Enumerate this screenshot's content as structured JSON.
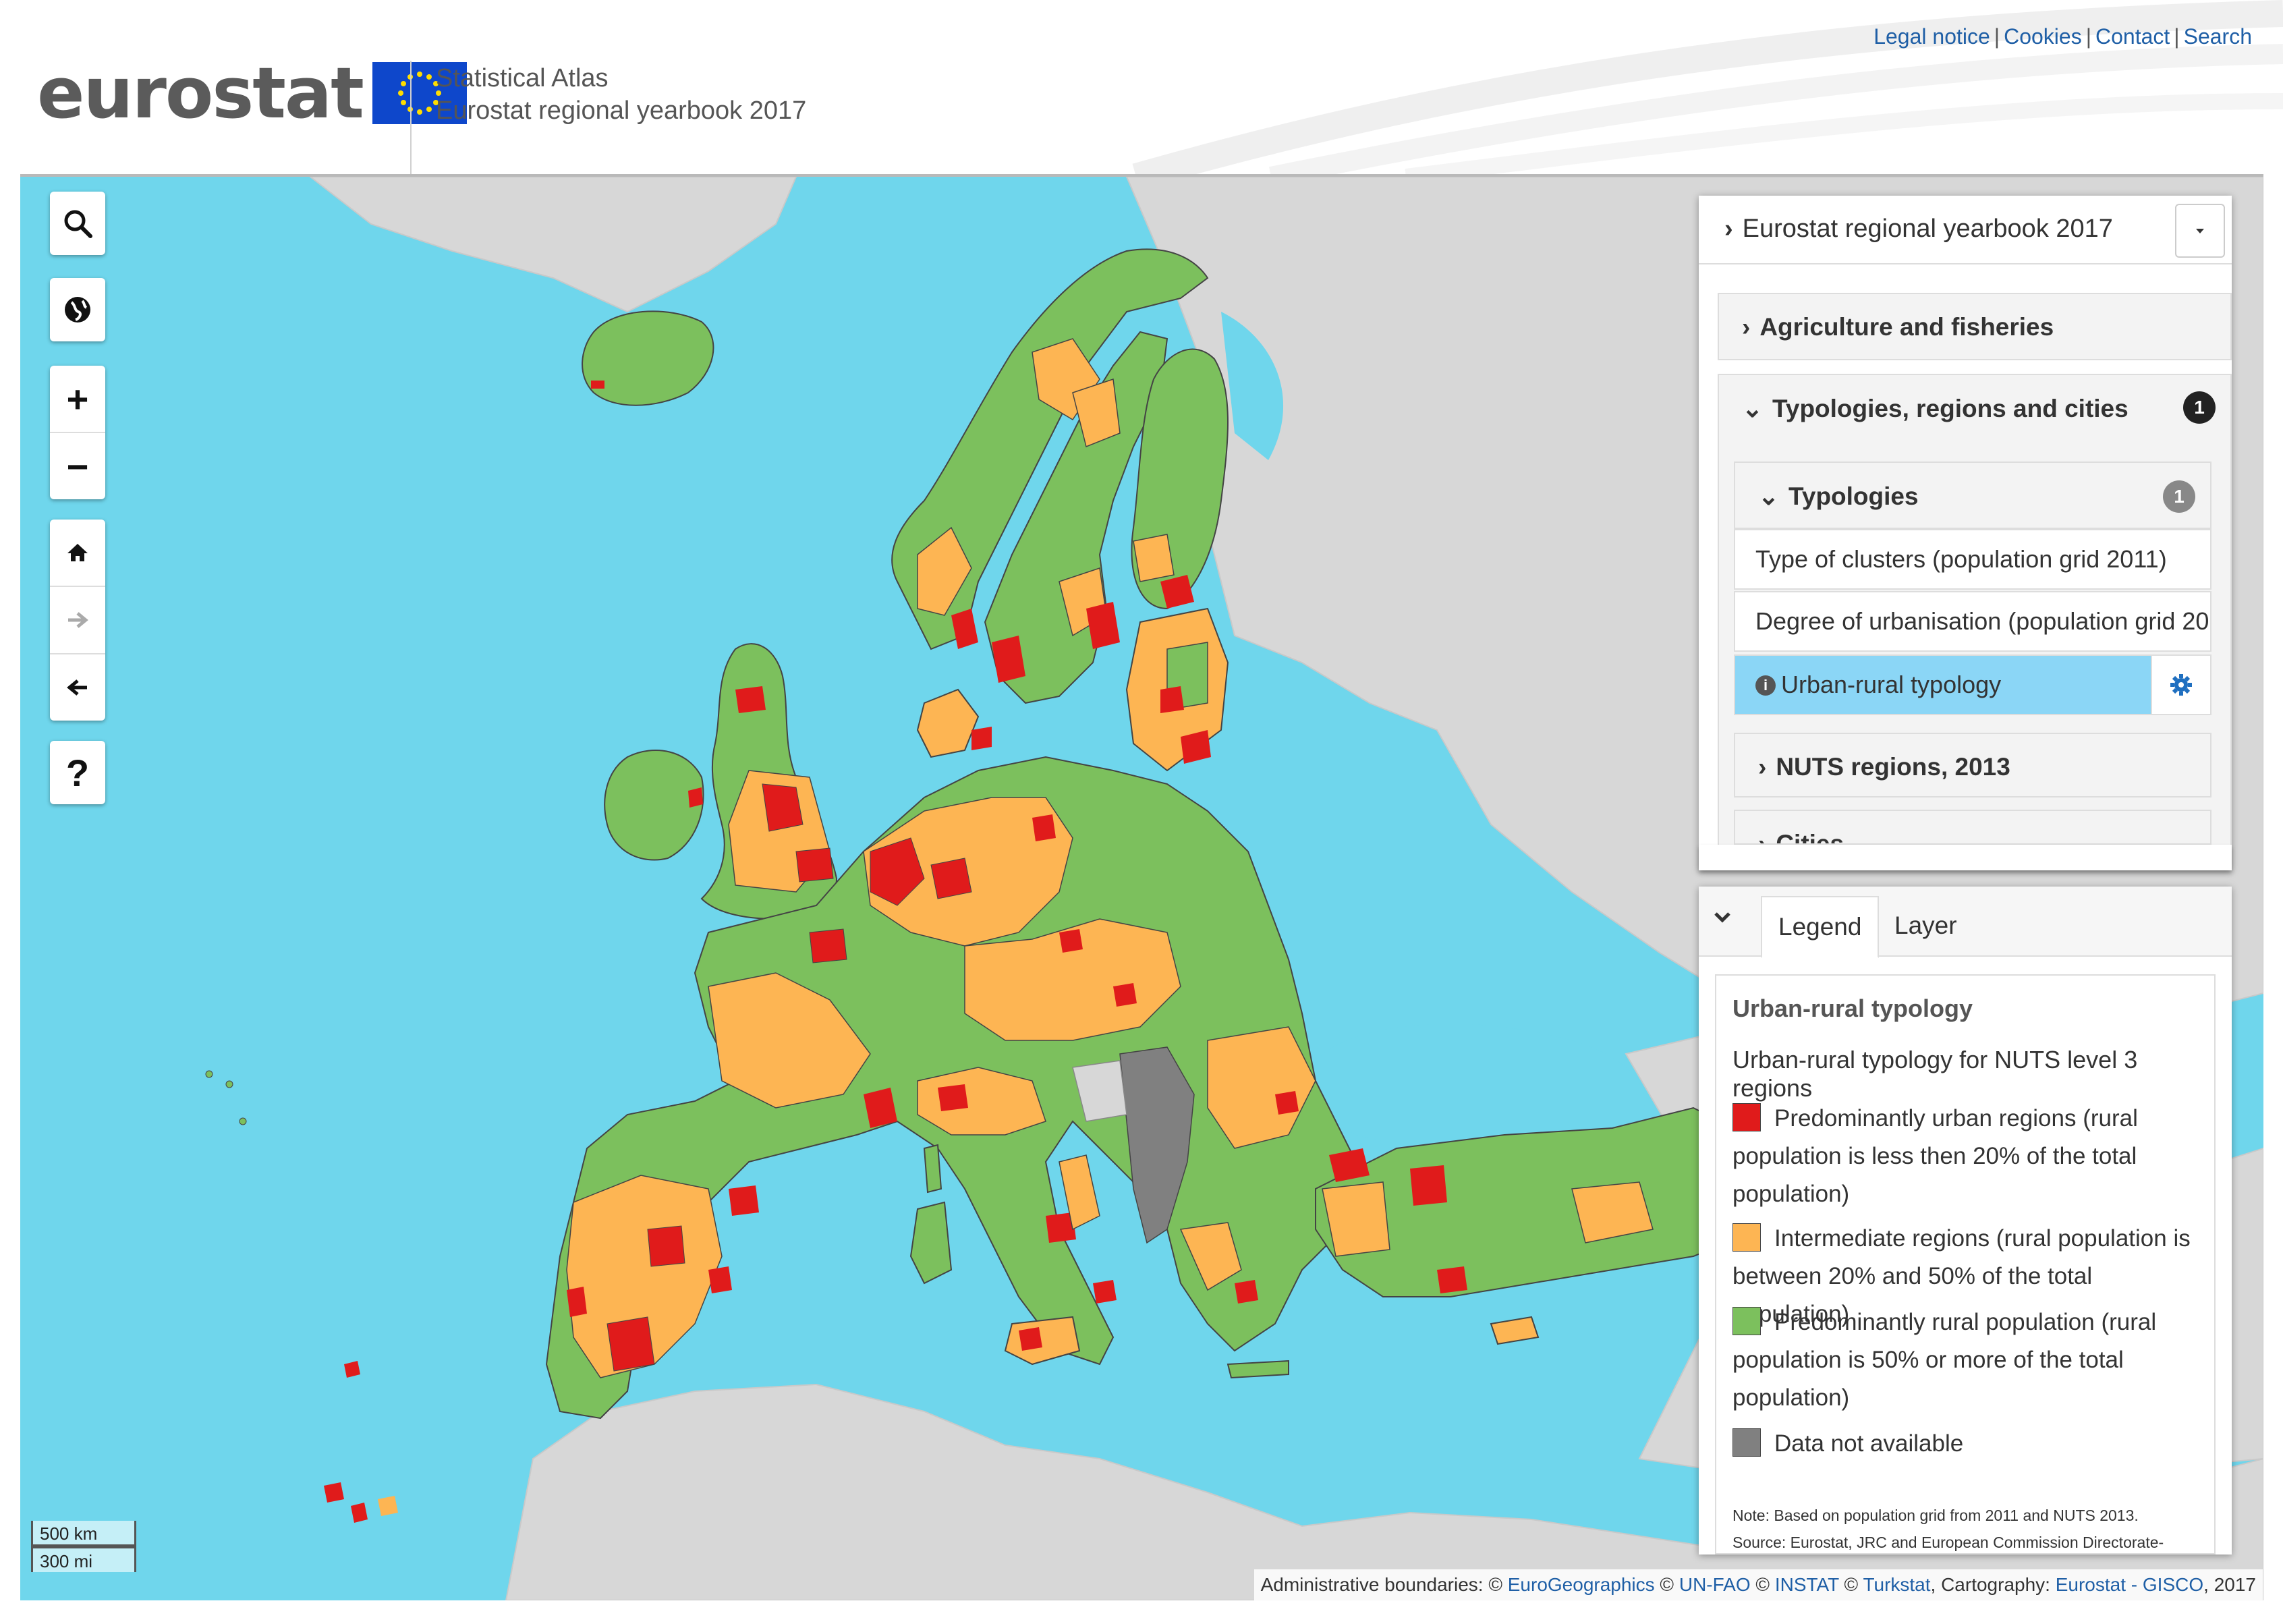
{
  "header": {
    "logo_text": "eurostat",
    "title_line1": "Statistical Atlas",
    "title_line2": "Eurostat regional yearbook 2017",
    "links": [
      "Legal notice",
      "Cookies",
      "Contact",
      "Search"
    ]
  },
  "toolbar": {
    "search": "search-icon",
    "globe": "globe-icon",
    "zoom_in": "+",
    "zoom_out": "−",
    "home": "home-icon",
    "forward": "arrow-right-icon",
    "back": "arrow-left-icon",
    "help": "?"
  },
  "scale": {
    "km": "500 km",
    "mi": "300 mi"
  },
  "attribution": {
    "prefix": "Administrative boundaries: © ",
    "eurogeo": "EuroGeographics",
    "c1": " © ",
    "unfao": "UN-FAO",
    "c2": " © ",
    "instat": "INSTAT",
    "c3": " © ",
    "turkstat": "Turkstat",
    "carto": ", Cartography: ",
    "gisco": "Eurostat - GISCO",
    "year": ", 2017"
  },
  "catalog": {
    "title": "Eurostat regional yearbook 2017",
    "sections": [
      {
        "label": "Agriculture and fisheries"
      },
      {
        "label": "Typologies, regions and cities",
        "badge": "1"
      }
    ],
    "subsection": {
      "label": "Typologies",
      "badge": "1"
    },
    "layers": [
      "Type of clusters (population grid 2011)",
      "Degree of urbanisation (population grid 20…",
      "Urban-rural typology"
    ],
    "nuts": "NUTS regions, 2013",
    "cities": "Cities"
  },
  "legend": {
    "tabs": [
      "Legend",
      "Layer"
    ],
    "title": "Urban-rural typology",
    "subtitle": "Urban-rural typology for NUTS level 3 regions",
    "items": [
      {
        "color": "#e01b1b",
        "label": "Predominantly urban regions (rural population is less then 20% of the total population)"
      },
      {
        "color": "#fdb553",
        "label": "Intermediate regions (rural population is between 20% and 50% of the total population)"
      },
      {
        "color": "#7cc05d",
        "label": "Predominantly rural population (rural population is 50% or more of the total population)"
      },
      {
        "color": "#808080",
        "label": "Data not available"
      }
    ],
    "note": "Note: Based on population grid from 2011 and NUTS 2013.",
    "source": "Source: Eurostat, JRC and European Commission Directorate-"
  },
  "colors": {
    "sea": "#6fd6ec",
    "land_other": "#d7d7d7",
    "urban": "#e01b1b",
    "intermediate": "#fdb553",
    "rural": "#7cc05d",
    "no_data": "#808080",
    "accent": "#1f5fa6"
  }
}
